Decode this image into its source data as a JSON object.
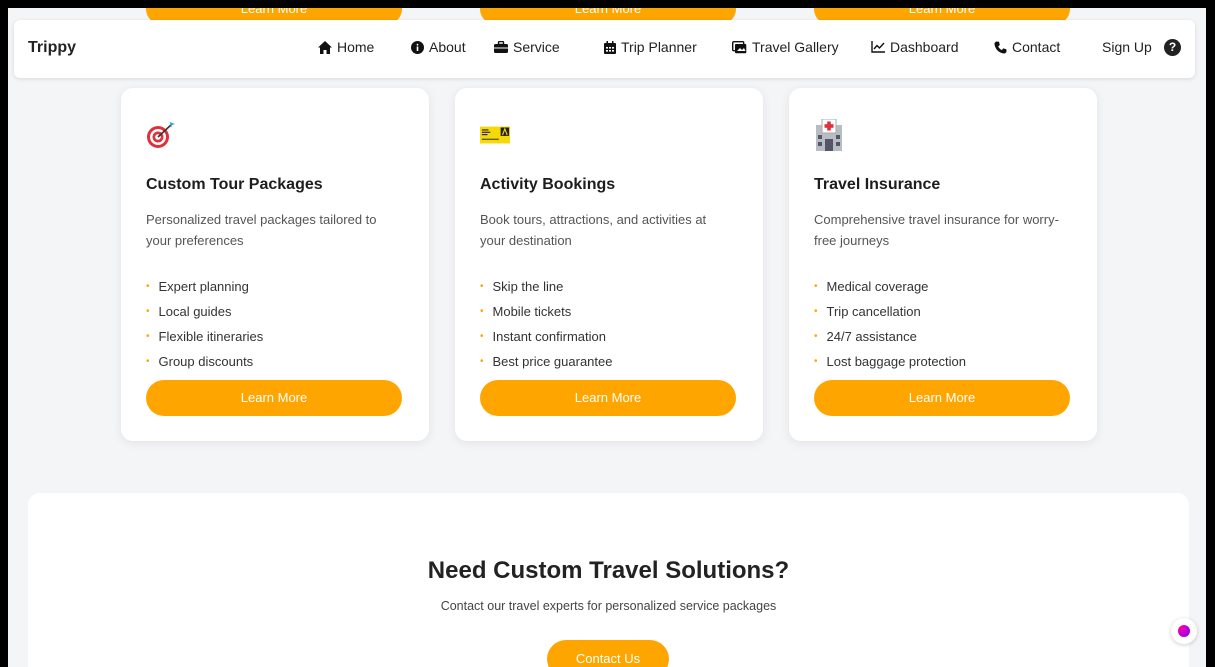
{
  "ghost_buttons": [
    "Learn More",
    "Learn More",
    "Learn More"
  ],
  "nav": {
    "brand": "Trippy",
    "items": [
      {
        "label": "Home",
        "icon": "home-icon"
      },
      {
        "label": "About",
        "icon": "info-icon"
      },
      {
        "label": "Service",
        "icon": "briefcase-icon"
      },
      {
        "label": "Trip Planner",
        "icon": "calendar-icon"
      },
      {
        "label": "Travel Gallery",
        "icon": "gallery-icon"
      },
      {
        "label": "Dashboard",
        "icon": "chart-line-icon"
      },
      {
        "label": "Contact",
        "icon": "phone-icon"
      }
    ],
    "signup": "Sign Up",
    "help": "?"
  },
  "cards": [
    {
      "icon": "target-icon",
      "title": "Custom Tour Packages",
      "desc": "Personalized travel packages tailored to your preferences",
      "features": [
        "Expert planning",
        "Local guides",
        "Flexible itineraries",
        "Group discounts"
      ],
      "button": "Learn More"
    },
    {
      "icon": "ticket-icon",
      "title": "Activity Bookings",
      "desc": "Book tours, attractions, and activities at your destination",
      "features": [
        "Skip the line",
        "Mobile tickets",
        "Instant confirmation",
        "Best price guarantee"
      ],
      "button": "Learn More"
    },
    {
      "icon": "hospital-icon",
      "title": "Travel Insurance",
      "desc": "Comprehensive travel insurance for worry-free journeys",
      "features": [
        "Medical coverage",
        "Trip cancellation",
        "24/7 assistance",
        "Lost baggage protection"
      ],
      "button": "Learn More"
    }
  ],
  "cta": {
    "title": "Need Custom Travel Solutions?",
    "subtitle": "Contact our travel experts for personalized service packages",
    "button": "Contact Us"
  },
  "colors": {
    "accent": "#ffa500",
    "background": "#f4f5f7",
    "card": "#ffffff"
  }
}
